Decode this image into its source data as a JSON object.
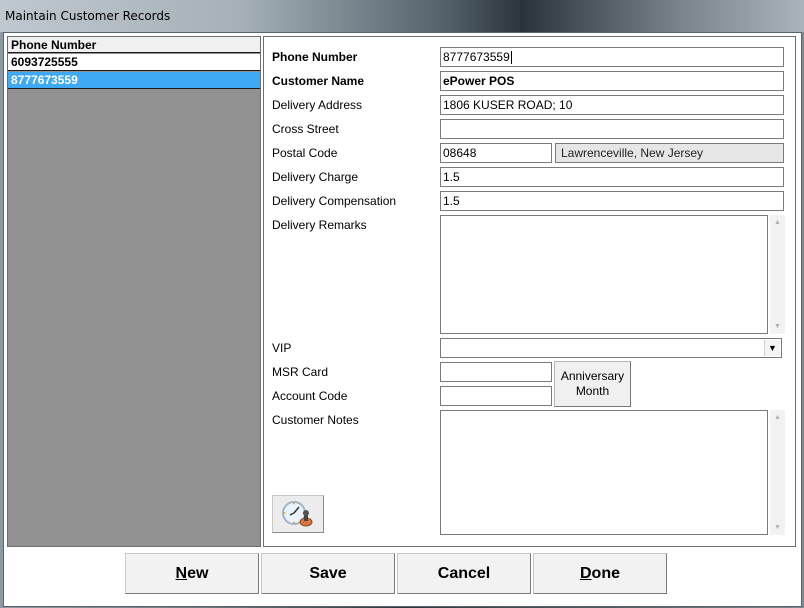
{
  "window": {
    "title": "Maintain Customer Records"
  },
  "list": {
    "header": "Phone Number",
    "rows": [
      {
        "phone": "6093725555",
        "selected": false
      },
      {
        "phone": "8777673559",
        "selected": true
      }
    ],
    "selected_color": "#3fa9f5"
  },
  "form": {
    "phone_number": {
      "label": "Phone Number",
      "value": "8777673559"
    },
    "customer_name": {
      "label": "Customer Name",
      "value": "ePower POS"
    },
    "delivery_address": {
      "label": "Delivery Address",
      "value": "1806 KUSER ROAD; 10"
    },
    "cross_street": {
      "label": "Cross Street",
      "value": ""
    },
    "postal_code": {
      "label": "Postal Code",
      "value": "08648",
      "city": "Lawrenceville, New Jersey"
    },
    "delivery_charge": {
      "label": "Delivery Charge",
      "value": "1.5"
    },
    "delivery_compensation": {
      "label": "Delivery Compensation",
      "value": "1.5"
    },
    "delivery_remarks": {
      "label": "Delivery Remarks",
      "value": ""
    },
    "vip": {
      "label": "VIP",
      "value": ""
    },
    "msr_card": {
      "label": "MSR Card",
      "value": ""
    },
    "account_code": {
      "label": "Account Code",
      "value": ""
    },
    "anniversary_button": {
      "line1": "Anniversary",
      "line2": "Month"
    },
    "customer_notes": {
      "label": "Customer Notes",
      "value": ""
    },
    "clock_icon": "clock-stamp-icon"
  },
  "buttons": {
    "new": {
      "first": "N",
      "rest": "ew"
    },
    "save": "Save",
    "cancel": "Cancel",
    "done": {
      "first": "D",
      "rest": "one"
    }
  }
}
